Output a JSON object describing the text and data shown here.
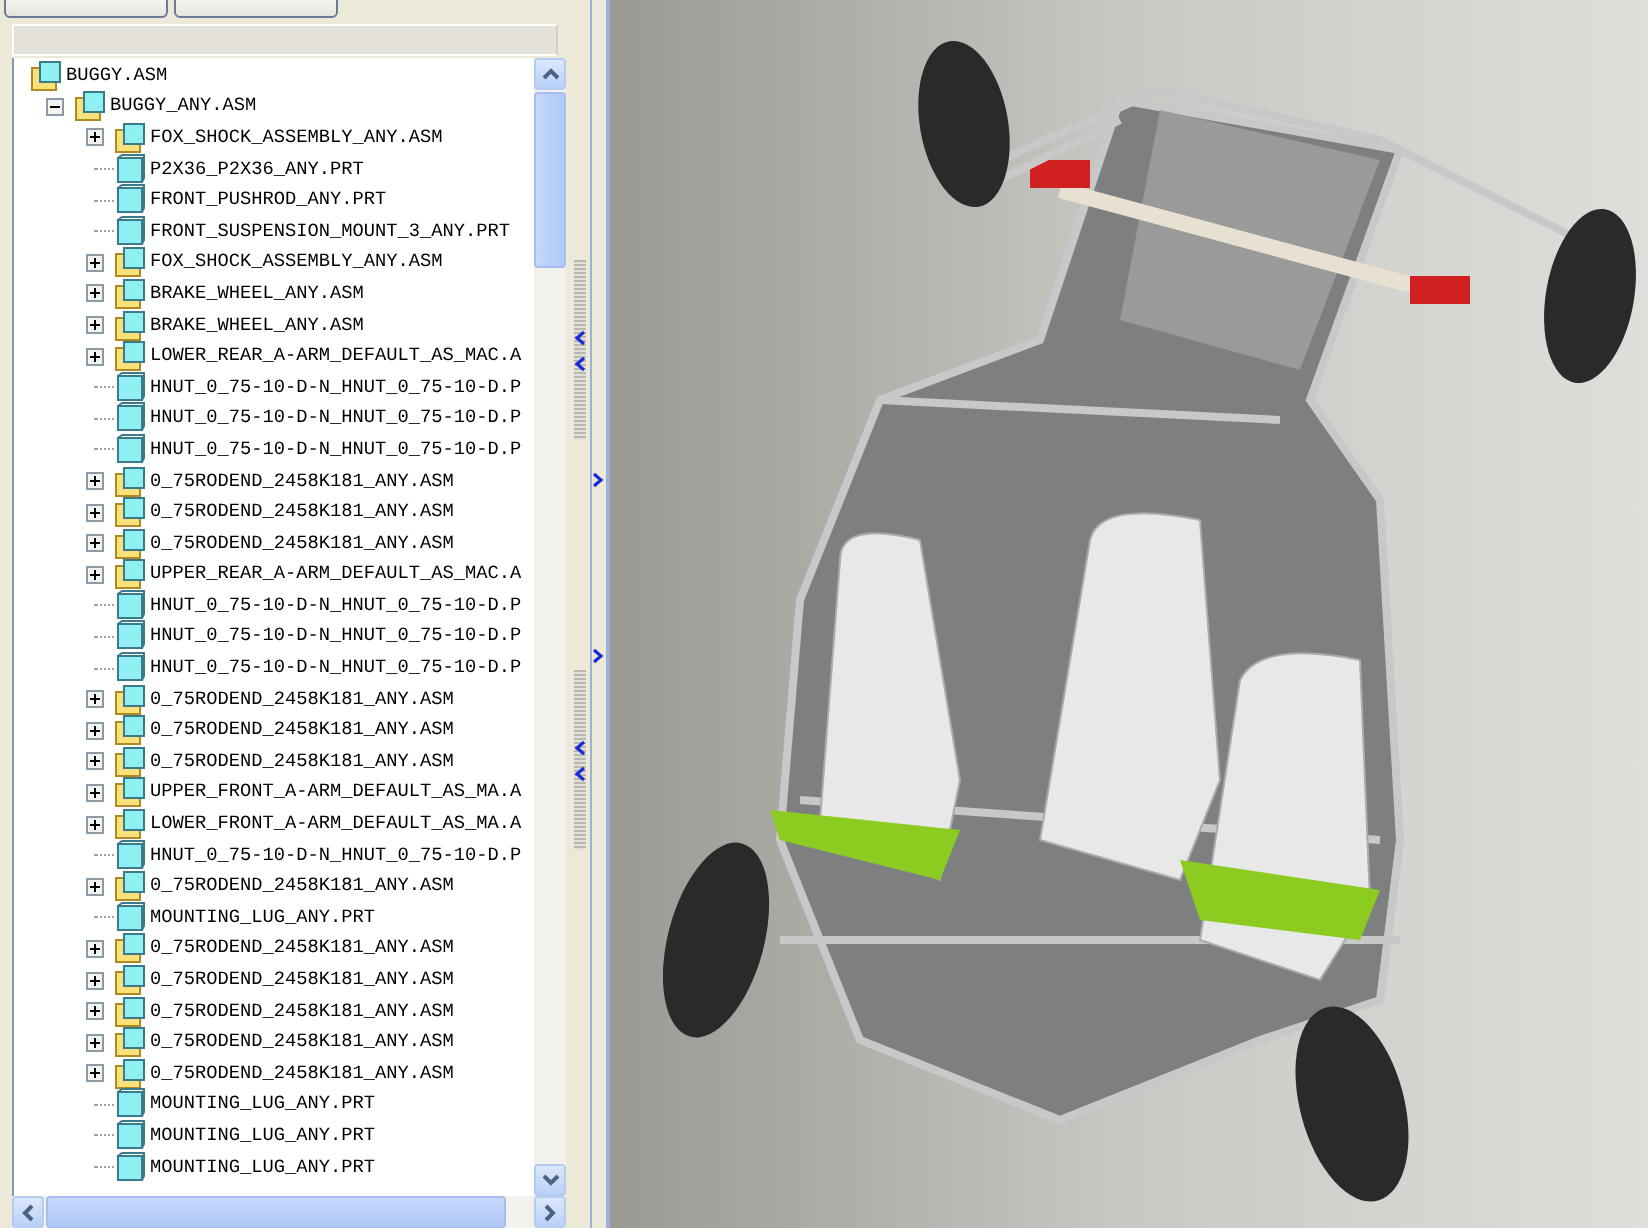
{
  "model_tree": {
    "items": [
      {
        "label": "BUGGY.ASM",
        "kind": "root",
        "children": [
          {
            "label": "BUGGY_ANY.ASM",
            "kind": "asm",
            "expanded": true,
            "children": [
              {
                "label": "FOX_SHOCK_ASSEMBLY_ANY.ASM",
                "kind": "asm",
                "expanded": false
              },
              {
                "label": "P2X36_P2X36_ANY.PRT",
                "kind": "prt"
              },
              {
                "label": "FRONT_PUSHROD_ANY.PRT",
                "kind": "prt"
              },
              {
                "label": "FRONT_SUSPENSION_MOUNT_3_ANY.PRT",
                "kind": "prt"
              },
              {
                "label": "FOX_SHOCK_ASSEMBLY_ANY.ASM",
                "kind": "asm",
                "expanded": false
              },
              {
                "label": "BRAKE_WHEEL_ANY.ASM",
                "kind": "asm",
                "expanded": false
              },
              {
                "label": "BRAKE_WHEEL_ANY.ASM",
                "kind": "asm",
                "expanded": false
              },
              {
                "label": "LOWER_REAR_A-ARM_DEFAULT_AS_MAC.A",
                "kind": "asm",
                "expanded": false
              },
              {
                "label": "HNUT_0_75-10-D-N_HNUT_0_75-10-D.P",
                "kind": "prt"
              },
              {
                "label": "HNUT_0_75-10-D-N_HNUT_0_75-10-D.P",
                "kind": "prt"
              },
              {
                "label": "HNUT_0_75-10-D-N_HNUT_0_75-10-D.P",
                "kind": "prt"
              },
              {
                "label": "0_75RODEND_2458K181_ANY.ASM",
                "kind": "asm",
                "expanded": false
              },
              {
                "label": "0_75RODEND_2458K181_ANY.ASM",
                "kind": "asm",
                "expanded": false
              },
              {
                "label": "0_75RODEND_2458K181_ANY.ASM",
                "kind": "asm",
                "expanded": false
              },
              {
                "label": "UPPER_REAR_A-ARM_DEFAULT_AS_MAC.A",
                "kind": "asm",
                "expanded": false
              },
              {
                "label": "HNUT_0_75-10-D-N_HNUT_0_75-10-D.P",
                "kind": "prt"
              },
              {
                "label": "HNUT_0_75-10-D-N_HNUT_0_75-10-D.P",
                "kind": "prt"
              },
              {
                "label": "HNUT_0_75-10-D-N_HNUT_0_75-10-D.P",
                "kind": "prt"
              },
              {
                "label": "0_75RODEND_2458K181_ANY.ASM",
                "kind": "asm",
                "expanded": false
              },
              {
                "label": "0_75RODEND_2458K181_ANY.ASM",
                "kind": "asm",
                "expanded": false
              },
              {
                "label": "0_75RODEND_2458K181_ANY.ASM",
                "kind": "asm",
                "expanded": false
              },
              {
                "label": "UPPER_FRONT_A-ARM_DEFAULT_AS_MA.A",
                "kind": "asm",
                "expanded": false
              },
              {
                "label": "LOWER_FRONT_A-ARM_DEFAULT_AS_MA.A",
                "kind": "asm",
                "expanded": false
              },
              {
                "label": "HNUT_0_75-10-D-N_HNUT_0_75-10-D.P",
                "kind": "prt"
              },
              {
                "label": "0_75RODEND_2458K181_ANY.ASM",
                "kind": "asm",
                "expanded": false
              },
              {
                "label": "MOUNTING_LUG_ANY.PRT",
                "kind": "prt"
              },
              {
                "label": "0_75RODEND_2458K181_ANY.ASM",
                "kind": "asm",
                "expanded": false
              },
              {
                "label": "0_75RODEND_2458K181_ANY.ASM",
                "kind": "asm",
                "expanded": false
              },
              {
                "label": "0_75RODEND_2458K181_ANY.ASM",
                "kind": "asm",
                "expanded": false
              },
              {
                "label": "0_75RODEND_2458K181_ANY.ASM",
                "kind": "asm",
                "expanded": false
              },
              {
                "label": "0_75RODEND_2458K181_ANY.ASM",
                "kind": "asm",
                "expanded": false
              },
              {
                "label": "MOUNTING_LUG_ANY.PRT",
                "kind": "prt"
              },
              {
                "label": "MOUNTING_LUG_ANY.PRT",
                "kind": "prt"
              },
              {
                "label": "MOUNTING_LUG_ANY.PRT",
                "kind": "prt"
              }
            ]
          }
        ]
      }
    ]
  }
}
